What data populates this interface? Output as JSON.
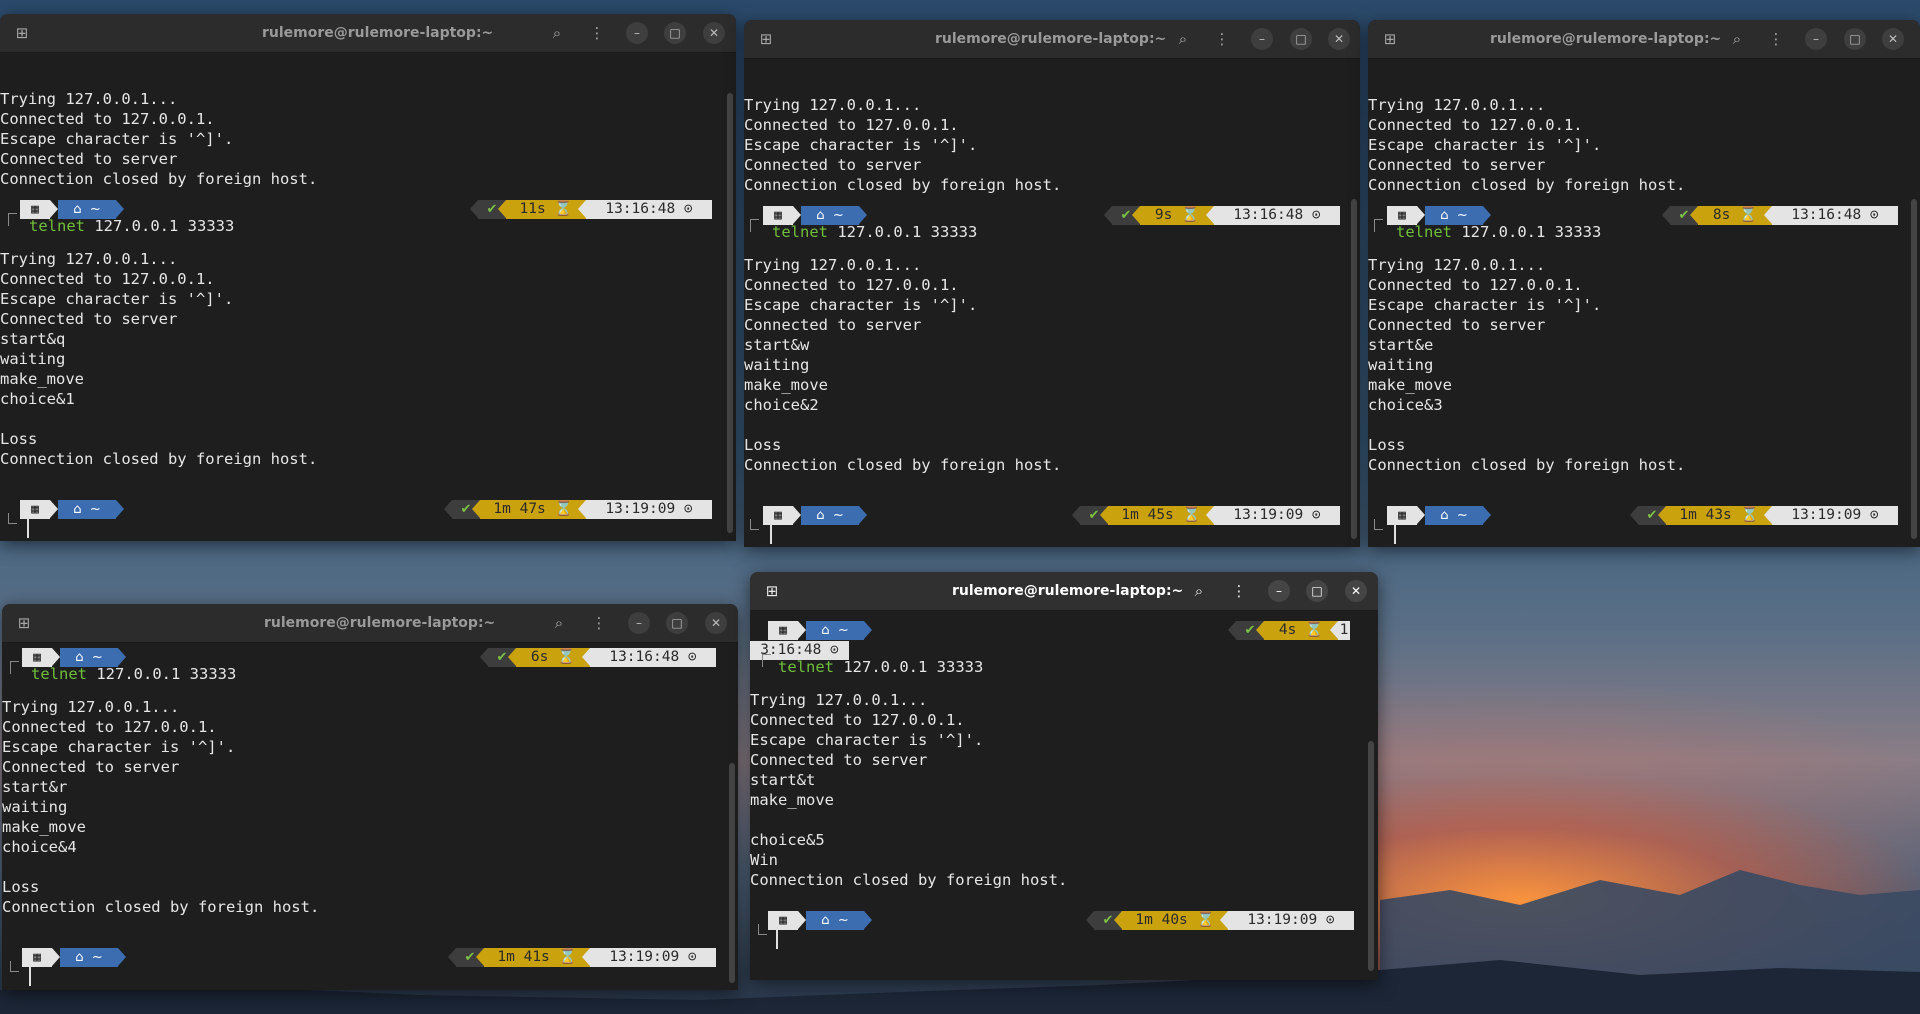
{
  "terminals": [
    {
      "title": "rulemore@rulemore-laptop:~",
      "active": false,
      "lines": [
        "Trying 127.0.0.1...",
        "Connected to 127.0.0.1.",
        "Escape character is '^]'.",
        "Connected to server",
        "Connection closed by foreign host."
      ],
      "prompt1": {
        "status": "✔",
        "duration": "11s ⌛",
        "time": "13:16:48 ⊙"
      },
      "command": {
        "keyword": "telnet",
        "args": " 127.0.0.1 33333"
      },
      "lines2": [
        "Trying 127.0.0.1...",
        "Connected to 127.0.0.1.",
        "Escape character is '^]'.",
        "Connected to server",
        "start&q",
        "waiting",
        "make_move",
        "choice&1",
        "",
        "Loss",
        "Connection closed by foreign host."
      ],
      "prompt2": {
        "status": "✔",
        "duration": "1m 47s ⌛",
        "time": "13:19:09 ⊙"
      }
    },
    {
      "title": "rulemore@rulemore-laptop:~",
      "active": false,
      "lines": [
        "Trying 127.0.0.1...",
        "Connected to 127.0.0.1.",
        "Escape character is '^]'.",
        "Connected to server",
        "Connection closed by foreign host."
      ],
      "prompt1": {
        "status": "✔",
        "duration": "9s ⌛",
        "time": "13:16:48 ⊙"
      },
      "command": {
        "keyword": "telnet",
        "args": " 127.0.0.1 33333"
      },
      "lines2": [
        "Trying 127.0.0.1...",
        "Connected to 127.0.0.1.",
        "Escape character is '^]'.",
        "Connected to server",
        "start&w",
        "waiting",
        "make_move",
        "choice&2",
        "",
        "Loss",
        "Connection closed by foreign host."
      ],
      "prompt2": {
        "status": "✔",
        "duration": "1m 45s ⌛",
        "time": "13:19:09 ⊙"
      }
    },
    {
      "title": "rulemore@rulemore-laptop:~",
      "active": false,
      "lines": [
        "Trying 127.0.0.1...",
        "Connected to 127.0.0.1.",
        "Escape character is '^]'.",
        "Connected to server",
        "Connection closed by foreign host."
      ],
      "prompt1": {
        "status": "✔",
        "duration": "8s ⌛",
        "time": "13:16:48 ⊙"
      },
      "command": {
        "keyword": "telnet",
        "args": " 127.0.0.1 33333"
      },
      "lines2": [
        "Trying 127.0.0.1...",
        "Connected to 127.0.0.1.",
        "Escape character is '^]'.",
        "Connected to server",
        "start&e",
        "waiting",
        "make_move",
        "choice&3",
        "",
        "Loss",
        "Connection closed by foreign host."
      ],
      "prompt2": {
        "status": "✔",
        "duration": "1m 43s ⌛",
        "time": "13:19:09 ⊙"
      }
    },
    {
      "title": "rulemore@rulemore-laptop:~",
      "active": false,
      "prompt1": {
        "status": "✔",
        "duration": "6s ⌛",
        "time": "13:16:48 ⊙"
      },
      "command": {
        "keyword": "telnet",
        "args": " 127.0.0.1 33333"
      },
      "lines2": [
        "Trying 127.0.0.1...",
        "Connected to 127.0.0.1.",
        "Escape character is '^]'.",
        "Connected to server",
        "start&r",
        "waiting",
        "make_move",
        "choice&4",
        "",
        "Loss",
        "Connection closed by foreign host."
      ],
      "prompt2": {
        "status": "✔",
        "duration": "1m 41s ⌛",
        "time": "13:19:09 ⊙"
      }
    },
    {
      "title": "rulemore@rulemore-laptop:~",
      "active": true,
      "prompt1": {
        "status": "✔",
        "duration": "4s ⌛",
        "time_a": "1",
        "time_b": "3:16:48 ⊙"
      },
      "command": {
        "keyword": "telnet",
        "args": " 127.0.0.1 33333"
      },
      "lines2": [
        "Trying 127.0.0.1...",
        "Connected to 127.0.0.1.",
        "Escape character is '^]'.",
        "Connected to server",
        "start&t",
        "make_move",
        "",
        "choice&5",
        "Win",
        "Connection closed by foreign host."
      ],
      "prompt2": {
        "status": "✔",
        "duration": "1m 40s ⌛",
        "time": "13:19:09 ⊙"
      }
    }
  ],
  "prompt_icons": {
    "os": "▦",
    "home": "⌂",
    "tilde": "~"
  },
  "titlebar_icons": {
    "new_tab": "⊞",
    "search": "⌕",
    "menu": "⋮",
    "minimize": "–",
    "maximize": "□",
    "close": "✕"
  },
  "colors": {
    "terminal_bg": "#1e1e1e",
    "telnet_green": "#6fbf3b",
    "duration_yellow": "#caa20e",
    "dir_blue": "#3c6db0"
  }
}
